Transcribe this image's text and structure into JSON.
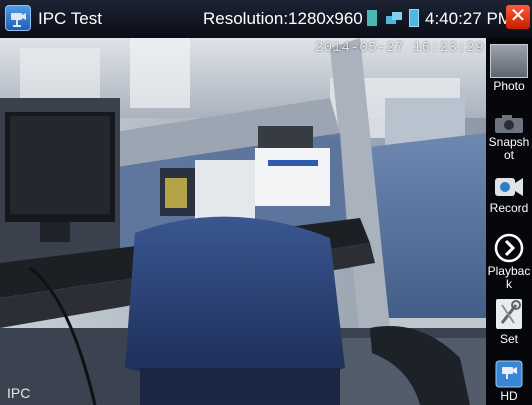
{
  "statusbar": {
    "title": "IPC Test",
    "resolution": "Resolution:1280x960",
    "clock": "4:40:27 PM",
    "close_symbol": "✕",
    "icons": [
      "app-camera-icon",
      "sim-card-icon",
      "network-icon",
      "battery-icon",
      "close-icon"
    ]
  },
  "camera": {
    "timestamp": "2014-05-27 16:23:29",
    "channel_label": "IPC"
  },
  "toolbar": {
    "items": [
      {
        "label": "Photo",
        "icon": "photo-thumbnail-icon"
      },
      {
        "label": "Snapshot",
        "icon": "snapshot-camera-icon"
      },
      {
        "label": "Record",
        "icon": "video-camera-icon"
      },
      {
        "label": "Playback",
        "icon": "play-icon"
      },
      {
        "label": "Set",
        "icon": "settings-tools-icon"
      },
      {
        "label": "HD",
        "icon": "hd-ipc-icon"
      }
    ]
  },
  "colors": {
    "statusbar_bg": "#141a27",
    "close_button": "#e03010",
    "battery": "#4fb6e0",
    "sim": "#49b8b1"
  }
}
